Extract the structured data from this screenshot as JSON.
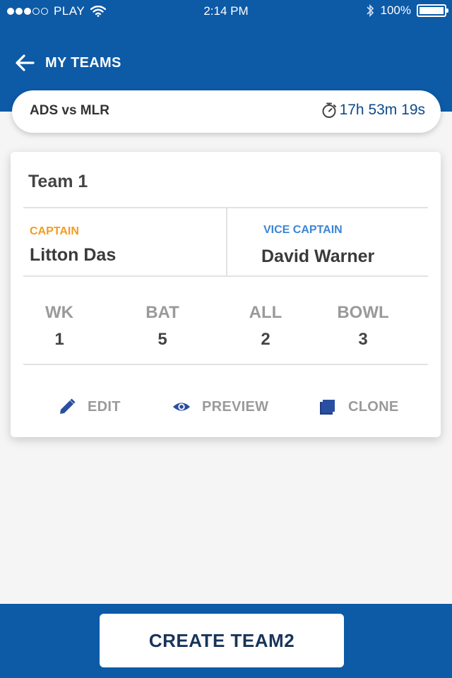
{
  "status_bar": {
    "carrier": "PLAY",
    "time": "2:14 PM",
    "battery": "100%",
    "signal_bars_filled": 3,
    "signal_bars_total": 5
  },
  "nav": {
    "title": "MY TEAMS",
    "back_icon": "arrow-left-icon"
  },
  "match": {
    "name": "ADS vs MLR",
    "countdown": "17h 53m 19s",
    "timer_icon": "stopwatch-icon"
  },
  "team": {
    "title": "Team 1",
    "captain_label": "CAPTAIN",
    "captain_name": "Litton Das",
    "vice_captain_label": "VICE CAPTAIN",
    "vice_captain_name": "David Warner",
    "stats": [
      {
        "label": "WK",
        "value": "1"
      },
      {
        "label": "BAT",
        "value": "5"
      },
      {
        "label": "ALL",
        "value": "2"
      },
      {
        "label": "BOWL",
        "value": "3"
      }
    ],
    "actions": [
      {
        "label": "EDIT",
        "icon": "pencil-icon"
      },
      {
        "label": "PREVIEW",
        "icon": "eye-icon"
      },
      {
        "label": "CLONE",
        "icon": "copy-icon"
      }
    ]
  },
  "footer": {
    "create_label": "CREATE TEAM2"
  },
  "colors": {
    "primary": "#0d5aa7",
    "captain": "#f39c1f",
    "vice_captain": "#3b86d6",
    "icon_blue": "#2a4fa0"
  }
}
